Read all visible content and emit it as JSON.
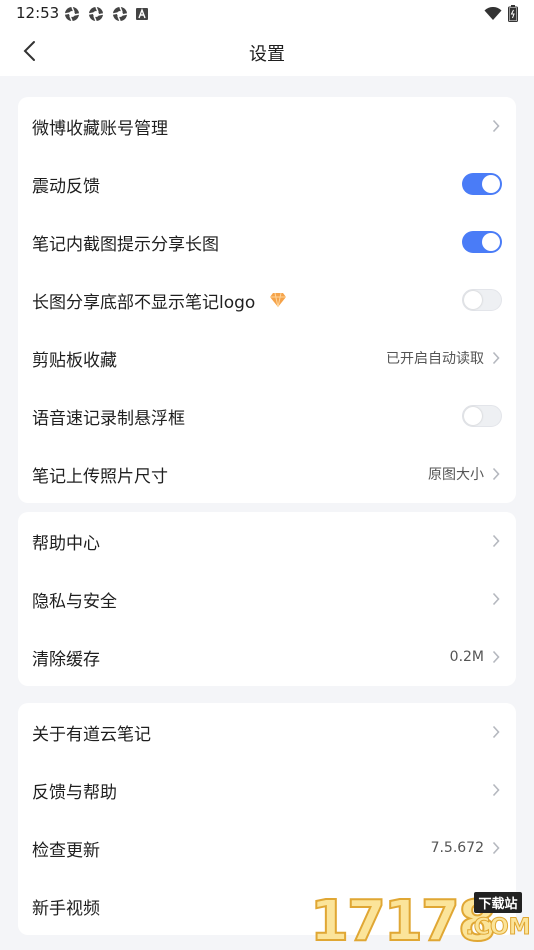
{
  "status_bar": {
    "time": "12:53",
    "icons": [
      "aperture-icon",
      "aperture-icon",
      "aperture-icon",
      "a-badge-icon"
    ],
    "right_icons": [
      "wifi-icon",
      "battery-icon"
    ]
  },
  "nav": {
    "title": "设置",
    "back_icon": "chevron-left-icon"
  },
  "groups": [
    {
      "rows": [
        {
          "label": "微博收藏账号管理",
          "type": "link"
        },
        {
          "label": "震动反馈",
          "type": "toggle",
          "on": true
        },
        {
          "label": "笔记内截图提示分享长图",
          "type": "toggle",
          "on": true
        },
        {
          "label": "长图分享底部不显示笔记logo",
          "type": "toggle",
          "on": false,
          "badge_icon": "vip-diamond-icon"
        },
        {
          "label": "剪贴板收藏",
          "type": "link",
          "value": "已开启自动读取"
        },
        {
          "label": "语音速记录制悬浮框",
          "type": "toggle",
          "on": false
        },
        {
          "label": "笔记上传照片尺寸",
          "type": "link",
          "value": "原图大小"
        }
      ]
    },
    {
      "rows": [
        {
          "label": "帮助中心",
          "type": "link"
        },
        {
          "label": "隐私与安全",
          "type": "link"
        },
        {
          "label": "清除缓存",
          "type": "link",
          "value": "0.2M"
        }
      ]
    },
    {
      "rows": [
        {
          "label": "关于有道云笔记",
          "type": "link"
        },
        {
          "label": "反馈与帮助",
          "type": "link"
        },
        {
          "label": "检查更新",
          "type": "link",
          "value": "7.5.672"
        },
        {
          "label": "新手视频",
          "type": "link"
        }
      ]
    }
  ],
  "watermark": {
    "digits": "17178",
    "tag": "下载站",
    "suffix": ".COM"
  },
  "colors": {
    "accent": "#4a7cf7",
    "background": "#f4f5f8",
    "card": "#ffffff",
    "badge": "#f5a34a"
  }
}
